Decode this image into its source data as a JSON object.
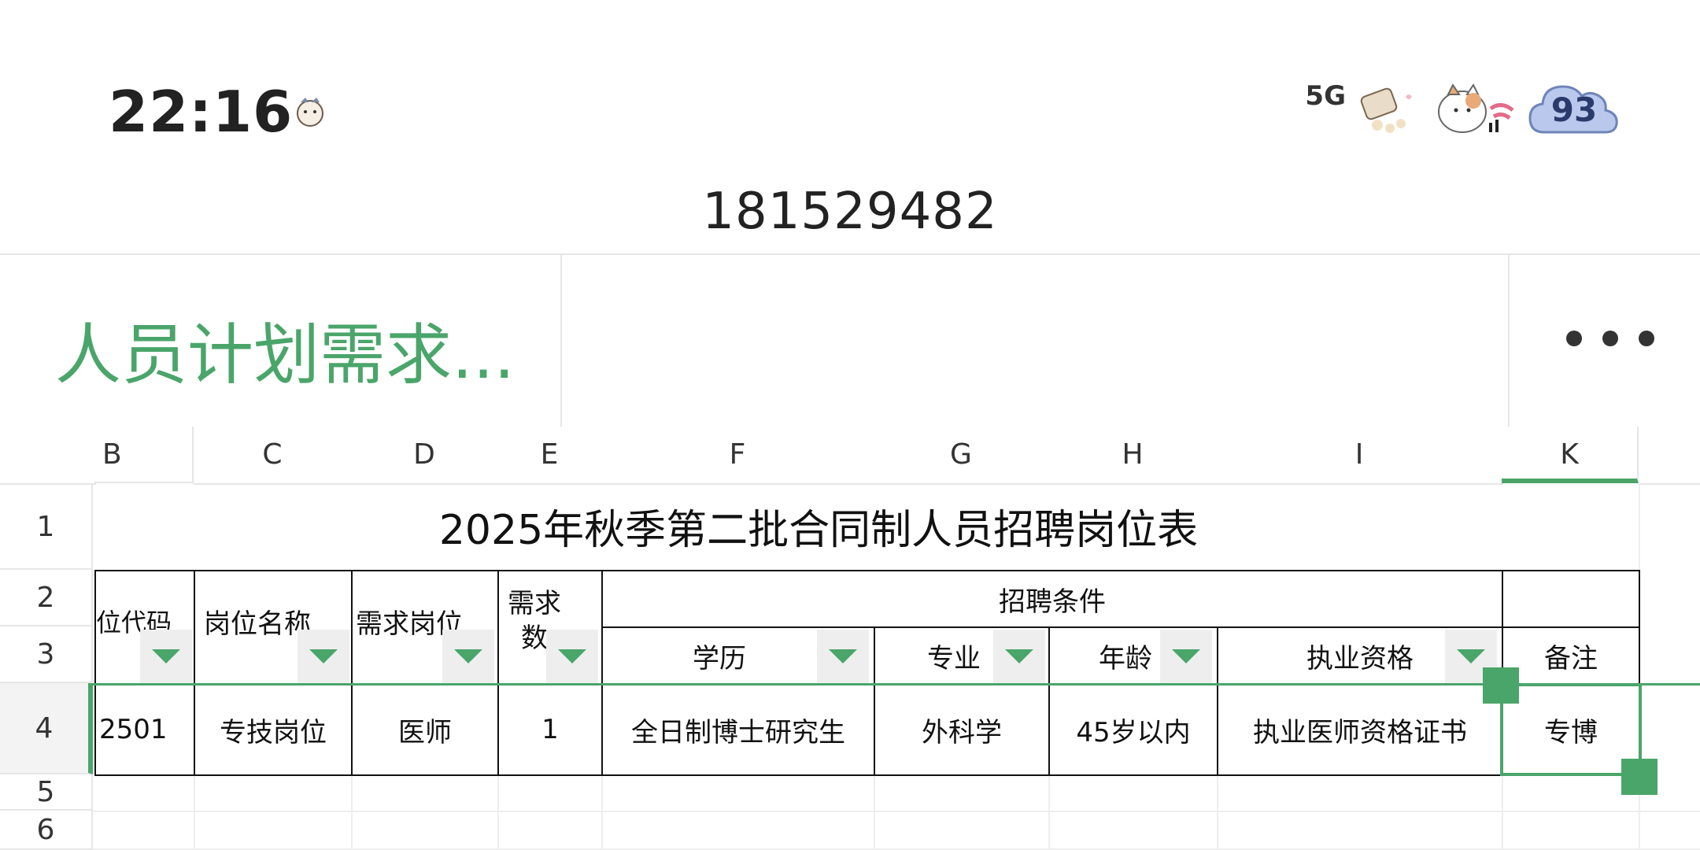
{
  "status_bar": {
    "time": "22:16",
    "network": "5G",
    "battery": "93"
  },
  "doc_id": "181529482",
  "toolbar": {
    "doc_title": "人员计划需求...",
    "more_icon": "more-horizontal-icon"
  },
  "columns": [
    "B",
    "C",
    "D",
    "E",
    "F",
    "G",
    "H",
    "I",
    "K"
  ],
  "rows": [
    "1",
    "2",
    "3",
    "4",
    "5",
    "6"
  ],
  "sheet": {
    "title": "2025年秋季第二批合同制人员招聘岗位表",
    "header_group": "招聘条件",
    "headers": {
      "b": "位代码",
      "c": "岗位名称",
      "d": "需求岗位",
      "e": "需求数",
      "f": "学历",
      "g": "专业",
      "h": "年龄",
      "i": "执业资格",
      "k": "备注"
    },
    "row4": {
      "b": "2501",
      "c": "专技岗位",
      "d": "医师",
      "e": "1",
      "f": "全日制博士研究生",
      "g": "外科学",
      "h": "45岁以内",
      "i": "执业医师资格证书",
      "k": "专博"
    }
  },
  "colors": {
    "accent": "#4aa56a",
    "grid": "#eeeeee",
    "text": "#111111"
  }
}
